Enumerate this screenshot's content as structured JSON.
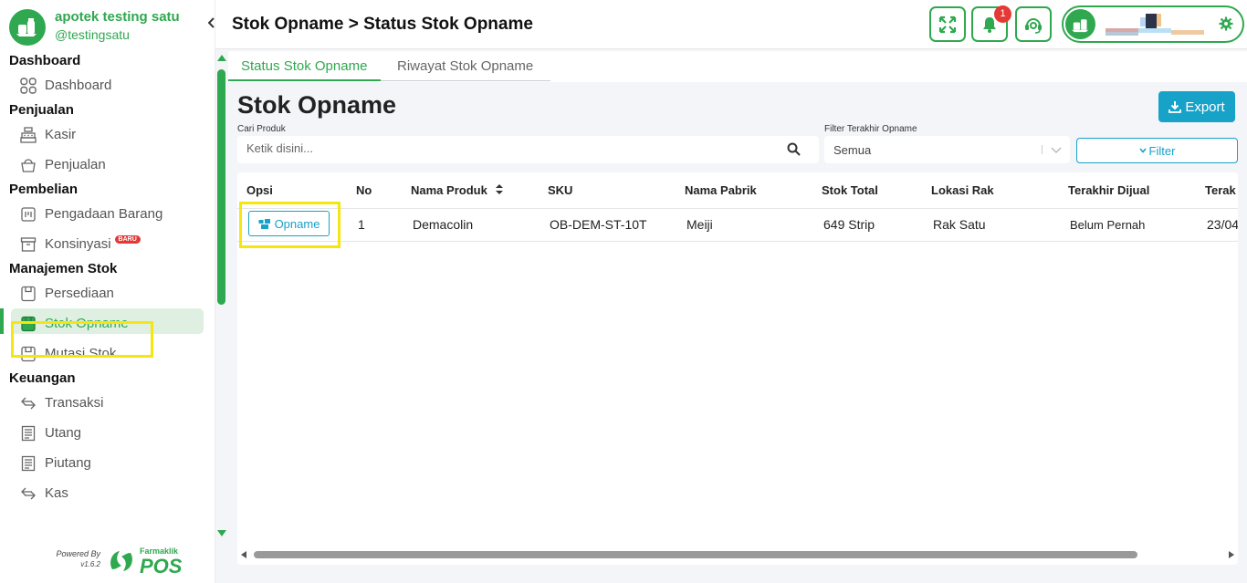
{
  "brand": {
    "name": "apotek testing satu",
    "handle": "@testingsatu"
  },
  "nav": {
    "sections": [
      {
        "title": "Dashboard",
        "items": [
          {
            "label": "Dashboard",
            "icon": "grid-icon"
          }
        ]
      },
      {
        "title": "Penjualan",
        "items": [
          {
            "label": "Kasir",
            "icon": "cash-register-icon"
          },
          {
            "label": "Penjualan",
            "icon": "basket-icon"
          }
        ]
      },
      {
        "title": "Pembelian",
        "items": [
          {
            "label": "Pengadaan Barang",
            "icon": "procurement-icon"
          },
          {
            "label": "Konsinyasi",
            "icon": "archive-box-icon",
            "badge": "BARU"
          }
        ]
      },
      {
        "title": "Manajemen Stok",
        "items": [
          {
            "label": "Persediaan",
            "icon": "box-icon"
          },
          {
            "label": "Stok Opname",
            "icon": "box-icon",
            "active": true
          },
          {
            "label": "Mutasi Stok",
            "icon": "box-icon"
          }
        ]
      },
      {
        "title": "Keuangan",
        "items": [
          {
            "label": "Transaksi",
            "icon": "transfer-arrows-icon"
          },
          {
            "label": "Utang",
            "icon": "receipt-icon"
          },
          {
            "label": "Piutang",
            "icon": "receipt-icon"
          },
          {
            "label": "Kas",
            "icon": "transfer-arrows-icon"
          }
        ]
      }
    ]
  },
  "footer": {
    "powered_by": "Powered By",
    "version": "v1.6.2",
    "logo_small": "Farmaklik",
    "logo_big": "POS"
  },
  "header": {
    "title": "Stok Opname > Status Stok Opname",
    "notification_count": "1"
  },
  "tabs": [
    {
      "label": "Status Stok Opname",
      "active": true
    },
    {
      "label": "Riwayat Stok Opname",
      "active": false
    }
  ],
  "main": {
    "heading": "Stok Opname",
    "export_label": "Export",
    "search": {
      "label": "Cari Produk",
      "placeholder": "Ketik disini..."
    },
    "filter": {
      "label": "Filter Terakhir Opname",
      "value": "Semua",
      "button_label": "Filter"
    }
  },
  "table": {
    "columns": [
      "Opsi",
      "No",
      "Nama Produk",
      "SKU",
      "Nama Pabrik",
      "Stok Total",
      "Lokasi Rak",
      "Terakhir Dijual",
      "Terak"
    ],
    "rows": [
      {
        "action": "Opname",
        "no": "1",
        "nama_produk": "Demacolin",
        "sku": "OB-DEM-ST-10T",
        "nama_pabrik": "Meiji",
        "stok_total": "649 Strip",
        "lokasi_rak": "Rak Satu",
        "terakhir_dijual": "Belum Pernah",
        "terakhir_opname": "23/04"
      }
    ]
  },
  "colors": {
    "primary_green": "#2fa84f",
    "accent_blue": "#17a2c8",
    "highlight": "#f5e60f",
    "badge_red": "#e53935"
  }
}
